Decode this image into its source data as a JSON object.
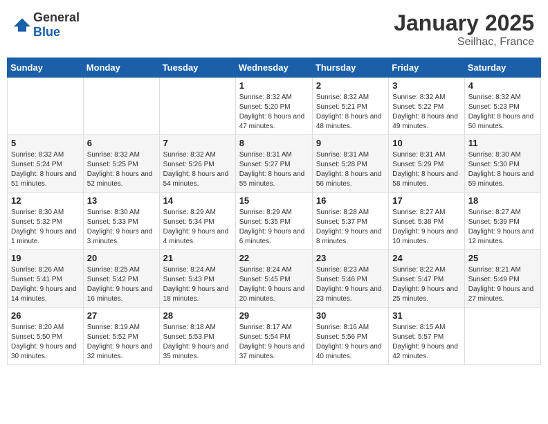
{
  "header": {
    "logo_general": "General",
    "logo_blue": "Blue",
    "month_year": "January 2025",
    "location": "Seilhac, France"
  },
  "days_of_week": [
    "Sunday",
    "Monday",
    "Tuesday",
    "Wednesday",
    "Thursday",
    "Friday",
    "Saturday"
  ],
  "weeks": [
    [
      {
        "day": "",
        "info": ""
      },
      {
        "day": "",
        "info": ""
      },
      {
        "day": "",
        "info": ""
      },
      {
        "day": "1",
        "info": "Sunrise: 8:32 AM\nSunset: 5:20 PM\nDaylight: 8 hours and 47 minutes."
      },
      {
        "day": "2",
        "info": "Sunrise: 8:32 AM\nSunset: 5:21 PM\nDaylight: 8 hours and 48 minutes."
      },
      {
        "day": "3",
        "info": "Sunrise: 8:32 AM\nSunset: 5:22 PM\nDaylight: 8 hours and 49 minutes."
      },
      {
        "day": "4",
        "info": "Sunrise: 8:32 AM\nSunset: 5:23 PM\nDaylight: 8 hours and 50 minutes."
      }
    ],
    [
      {
        "day": "5",
        "info": "Sunrise: 8:32 AM\nSunset: 5:24 PM\nDaylight: 8 hours and 51 minutes."
      },
      {
        "day": "6",
        "info": "Sunrise: 8:32 AM\nSunset: 5:25 PM\nDaylight: 8 hours and 52 minutes."
      },
      {
        "day": "7",
        "info": "Sunrise: 8:32 AM\nSunset: 5:26 PM\nDaylight: 8 hours and 54 minutes."
      },
      {
        "day": "8",
        "info": "Sunrise: 8:31 AM\nSunset: 5:27 PM\nDaylight: 8 hours and 55 minutes."
      },
      {
        "day": "9",
        "info": "Sunrise: 8:31 AM\nSunset: 5:28 PM\nDaylight: 8 hours and 56 minutes."
      },
      {
        "day": "10",
        "info": "Sunrise: 8:31 AM\nSunset: 5:29 PM\nDaylight: 8 hours and 58 minutes."
      },
      {
        "day": "11",
        "info": "Sunrise: 8:30 AM\nSunset: 5:30 PM\nDaylight: 8 hours and 59 minutes."
      }
    ],
    [
      {
        "day": "12",
        "info": "Sunrise: 8:30 AM\nSunset: 5:32 PM\nDaylight: 9 hours and 1 minute."
      },
      {
        "day": "13",
        "info": "Sunrise: 8:30 AM\nSunset: 5:33 PM\nDaylight: 9 hours and 3 minutes."
      },
      {
        "day": "14",
        "info": "Sunrise: 8:29 AM\nSunset: 5:34 PM\nDaylight: 9 hours and 4 minutes."
      },
      {
        "day": "15",
        "info": "Sunrise: 8:29 AM\nSunset: 5:35 PM\nDaylight: 9 hours and 6 minutes."
      },
      {
        "day": "16",
        "info": "Sunrise: 8:28 AM\nSunset: 5:37 PM\nDaylight: 9 hours and 8 minutes."
      },
      {
        "day": "17",
        "info": "Sunrise: 8:27 AM\nSunset: 5:38 PM\nDaylight: 9 hours and 10 minutes."
      },
      {
        "day": "18",
        "info": "Sunrise: 8:27 AM\nSunset: 5:39 PM\nDaylight: 9 hours and 12 minutes."
      }
    ],
    [
      {
        "day": "19",
        "info": "Sunrise: 8:26 AM\nSunset: 5:41 PM\nDaylight: 9 hours and 14 minutes."
      },
      {
        "day": "20",
        "info": "Sunrise: 8:25 AM\nSunset: 5:42 PM\nDaylight: 9 hours and 16 minutes."
      },
      {
        "day": "21",
        "info": "Sunrise: 8:24 AM\nSunset: 5:43 PM\nDaylight: 9 hours and 18 minutes."
      },
      {
        "day": "22",
        "info": "Sunrise: 8:24 AM\nSunset: 5:45 PM\nDaylight: 9 hours and 20 minutes."
      },
      {
        "day": "23",
        "info": "Sunrise: 8:23 AM\nSunset: 5:46 PM\nDaylight: 9 hours and 23 minutes."
      },
      {
        "day": "24",
        "info": "Sunrise: 8:22 AM\nSunset: 5:47 PM\nDaylight: 9 hours and 25 minutes."
      },
      {
        "day": "25",
        "info": "Sunrise: 8:21 AM\nSunset: 5:49 PM\nDaylight: 9 hours and 27 minutes."
      }
    ],
    [
      {
        "day": "26",
        "info": "Sunrise: 8:20 AM\nSunset: 5:50 PM\nDaylight: 9 hours and 30 minutes."
      },
      {
        "day": "27",
        "info": "Sunrise: 8:19 AM\nSunset: 5:52 PM\nDaylight: 9 hours and 32 minutes."
      },
      {
        "day": "28",
        "info": "Sunrise: 8:18 AM\nSunset: 5:53 PM\nDaylight: 9 hours and 35 minutes."
      },
      {
        "day": "29",
        "info": "Sunrise: 8:17 AM\nSunset: 5:54 PM\nDaylight: 9 hours and 37 minutes."
      },
      {
        "day": "30",
        "info": "Sunrise: 8:16 AM\nSunset: 5:56 PM\nDaylight: 9 hours and 40 minutes."
      },
      {
        "day": "31",
        "info": "Sunrise: 8:15 AM\nSunset: 5:57 PM\nDaylight: 9 hours and 42 minutes."
      },
      {
        "day": "",
        "info": ""
      }
    ]
  ]
}
